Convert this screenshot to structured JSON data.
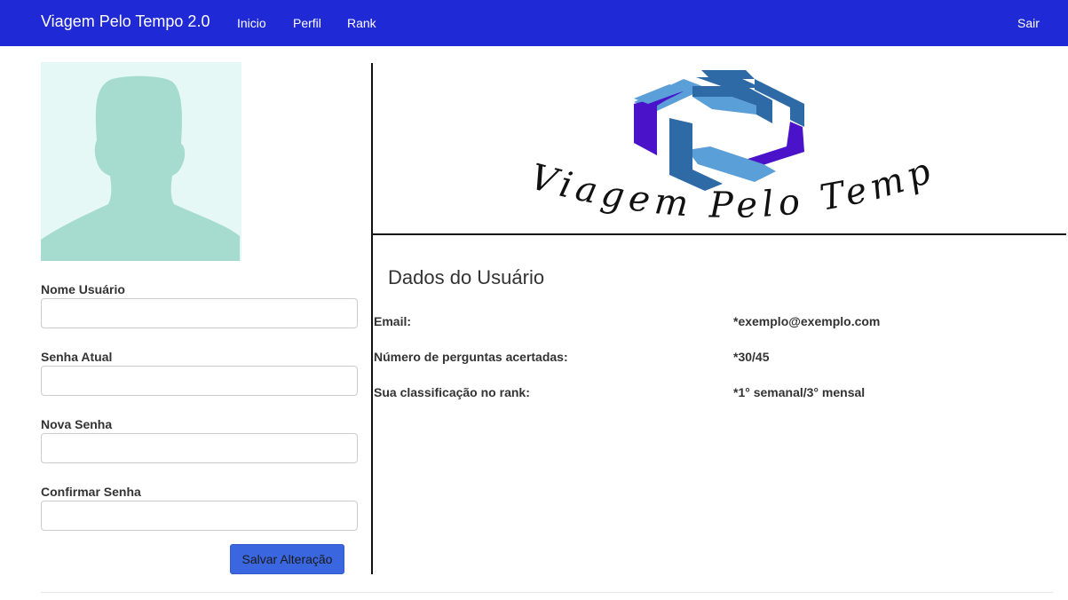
{
  "navbar": {
    "brand": "Viagem Pelo Tempo 2.0",
    "links": [
      "Inicio",
      "Perfil",
      "Rank"
    ],
    "logout": "Sair"
  },
  "form": {
    "username_label": "Nome Usuário",
    "current_password_label": "Senha Atual",
    "new_password_label": "Nova Senha",
    "confirm_password_label": "Confirmar Senha",
    "username_value": "",
    "current_password_value": "",
    "new_password_value": "",
    "confirm_password_value": "",
    "save_label": "Salvar Alteração"
  },
  "logo": {
    "text": "Viagem Pelo Tempo"
  },
  "user_data": {
    "title": "Dados do Usuário",
    "rows": [
      {
        "label": "Email:",
        "value": "*exemplo@exemplo.com"
      },
      {
        "label": "Número de perguntas acertadas:",
        "value": "*30/45"
      },
      {
        "label": "Sua classificação no rank:",
        "value": "*1° semanal/3° mensal"
      }
    ]
  },
  "colors": {
    "navbar": "#2029d6",
    "button": "#3a66e0",
    "avatar_bg": "#e6f8f6",
    "avatar_silhouette": "#a5dccf",
    "logo_dark": "#2d6aa6",
    "logo_light": "#5b9fd8",
    "logo_purple": "#4a12c9"
  },
  "icons": {
    "avatar": "user-silhouette-icon"
  }
}
